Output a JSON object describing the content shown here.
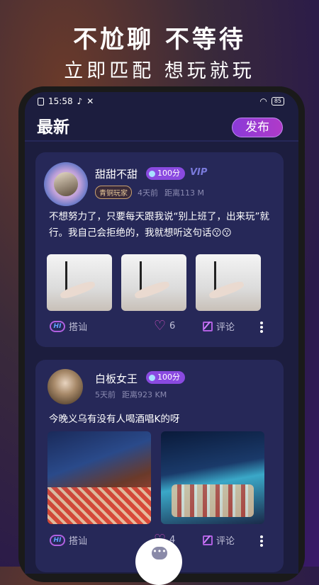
{
  "promo": {
    "line1": "不尬聊 不等待",
    "line2": "立即匹配 想玩就玩"
  },
  "status": {
    "time": "15:58",
    "battery": "85"
  },
  "header": {
    "title": "最新",
    "publish_label": "发布"
  },
  "posts": [
    {
      "username": "甜甜不甜",
      "coins": "100分",
      "vip": "VIP",
      "level": "青铜玩家",
      "time": "4天前",
      "distance": "距离113 M",
      "text": "不想努力了，只要每天跟我说“别上班了，出来玩”就行。我自己会拒绝的，我就想听这句话😗😗",
      "photo_count": 3,
      "hi_label": "搭讪",
      "likes": "6",
      "comment_label": "评论"
    },
    {
      "username": "白板女王",
      "coins": "100分",
      "time": "5天前",
      "distance": "距离923 KM",
      "text": "今晚义乌有没有人喝酒唱K的呀",
      "photo_count": 2,
      "hi_label": "搭讪",
      "likes": "4",
      "comment_label": "评论"
    }
  ],
  "colors": {
    "accent": "#8a3ad8",
    "card_bg": "#262858",
    "screen_bg": "#1c1d3e"
  },
  "icons": [
    "hi-chat-icon",
    "heart-icon",
    "edit-icon",
    "more-dots-icon",
    "chat-bubble-icon"
  ]
}
